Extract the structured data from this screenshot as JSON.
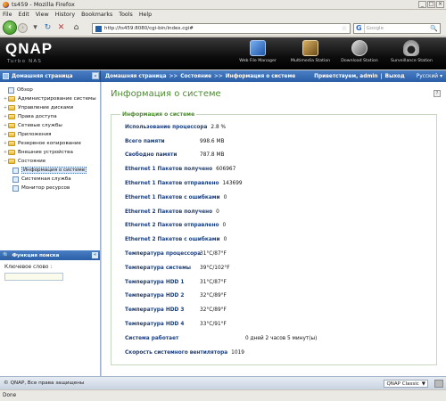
{
  "window": {
    "title": "ts459 - Mozilla Firefox",
    "buttons": [
      "_",
      "□",
      "×"
    ]
  },
  "menu": [
    "File",
    "Edit",
    "View",
    "History",
    "Bookmarks",
    "Tools",
    "Help"
  ],
  "nav": {
    "url": "http://ts459:8080/cgi-bin/index.cgi#",
    "search_placeholder": "Google"
  },
  "brand": {
    "logo": "QNAP",
    "subtitle": "Turbo NAS"
  },
  "stations": [
    "Web File Manager",
    "Multimedia Station",
    "Download Station",
    "Surveillance Station"
  ],
  "header": {
    "home": "Домашняя страница",
    "crumbs": [
      "Домашняя страница",
      "Состояние",
      "Информация о системе"
    ],
    "sep": ">>",
    "welcome": "Приветствуем, admin",
    "divider": "|",
    "logout": "Выход",
    "language": "Русский"
  },
  "tree": [
    {
      "label": "Обзор",
      "type": "doc",
      "level": 0
    },
    {
      "label": "Администрирование системы",
      "type": "folder",
      "level": 0
    },
    {
      "label": "Управление дисками",
      "type": "folder",
      "level": 0
    },
    {
      "label": "Права доступа",
      "type": "folder",
      "level": 0
    },
    {
      "label": "Сетевые службы",
      "type": "folder",
      "level": 0
    },
    {
      "label": "Приложения",
      "type": "folder",
      "level": 0
    },
    {
      "label": "Резервное копирование",
      "type": "folder",
      "level": 0
    },
    {
      "label": "Внешние устройства",
      "type": "folder",
      "level": 0
    },
    {
      "label": "Состояние",
      "type": "folder",
      "level": 0,
      "expanded": true
    },
    {
      "label": "Информация о системе",
      "type": "doc",
      "level": 1,
      "selected": true
    },
    {
      "label": "Системная служба",
      "type": "doc",
      "level": 1
    },
    {
      "label": "Монитор ресурсов",
      "type": "doc",
      "level": 1
    }
  ],
  "search_panel": {
    "title": "Функция поиска",
    "keyword_label": "Ключевое слово :"
  },
  "content": {
    "title": "Информация о системе",
    "group_title": "Информация о системе",
    "rows": [
      {
        "k": "Использование процессора",
        "v": "2.8 %",
        "w": "none"
      },
      {
        "k": "Всего памяти",
        "v": "998.6 MB",
        "w": "fixed"
      },
      {
        "k": "Свободно памяти",
        "v": "787.8 MB",
        "w": "fixed"
      },
      {
        "k": "Ethernet 1 Пакетов получено",
        "v": "606967",
        "w": "none"
      },
      {
        "k": "Ethernet 1 Пакетов отправлено",
        "v": "143699",
        "w": "none"
      },
      {
        "k": "Ethernet 1 Пакетов с ошибками",
        "v": "0",
        "w": "none"
      },
      {
        "k": "Ethernet 2 Пакетов получено",
        "v": "0",
        "w": "none"
      },
      {
        "k": "Ethernet 2 Пакетов отправлено",
        "v": "0",
        "w": "none"
      },
      {
        "k": "Ethernet 2 Пакетов с ошибками",
        "v": "0",
        "w": "none"
      },
      {
        "k": "Температура процессора",
        "v": "31°C/87°F",
        "w": "fixed"
      },
      {
        "k": "Температура системы",
        "v": "39°C/102°F",
        "w": "fixed"
      },
      {
        "k": "Температура HDD 1",
        "v": "31°C/87°F",
        "w": "fixed"
      },
      {
        "k": "Температура HDD 2",
        "v": "32°C/89°F",
        "w": "fixed"
      },
      {
        "k": "Температура HDD 3",
        "v": "32°C/89°F",
        "w": "fixed"
      },
      {
        "k": "Температура HDD 4",
        "v": "33°C/91°F",
        "w": "fixed"
      },
      {
        "k": "Система работает",
        "v": "0 дней 2 часов 5 минут(ы)",
        "w": "fixedw"
      },
      {
        "k": "Скорость системного вентилятора",
        "v": "1019",
        "w": "none"
      }
    ]
  },
  "footer": {
    "copyright": "©",
    "text": "QNAP, Все права защищены",
    "theme": "QNAP Classic",
    "theme_arrow": "▼"
  },
  "status": {
    "text": "Done"
  },
  "icons": {
    "dropdown": "▾",
    "star": "☆",
    "search": "🔍",
    "reload": "↻",
    "stop": "✕",
    "home": "⌂",
    "expand": "+",
    "collapse": "−",
    "collapse_panel": "«",
    "help": "?"
  }
}
